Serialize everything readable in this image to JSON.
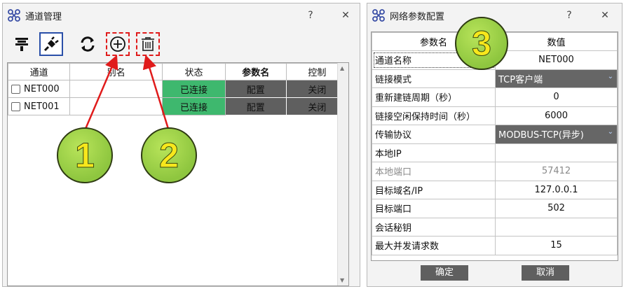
{
  "left_window": {
    "title": "通道管理",
    "help_label": "?",
    "close_label": "✕",
    "columns": [
      "通道",
      "别名",
      "状态",
      "参数名",
      "控制"
    ],
    "rows": [
      {
        "channel": "NET000",
        "alias": "",
        "status": "已连接",
        "param_btn": "配置",
        "control_btn": "关闭"
      },
      {
        "channel": "NET001",
        "alias": "",
        "status": "已连接",
        "param_btn": "配置",
        "control_btn": "关闭"
      }
    ],
    "toolbar": [
      "plug-icon",
      "ethernet-icon",
      "refresh-icon",
      "add-icon",
      "delete-icon"
    ]
  },
  "right_window": {
    "title": "网络参数配置",
    "help_label": "?",
    "close_label": "✕",
    "header": {
      "key": "参数名",
      "value": "数值"
    },
    "params": [
      {
        "key": "通道名称",
        "value": "NET000",
        "kind": "text"
      },
      {
        "key": "链接模式",
        "value": "TCP客户端",
        "kind": "dropdown"
      },
      {
        "key": "重新建链周期（秒）",
        "value": "0",
        "kind": "text"
      },
      {
        "key": "链接空闲保持时间（秒）",
        "value": "6000",
        "kind": "text"
      },
      {
        "key": "传输协议",
        "value": "MODBUS-TCP(异步)",
        "kind": "dropdown"
      },
      {
        "key": "本地IP",
        "value": "",
        "kind": "text"
      },
      {
        "key": "本地端口",
        "value": "57412",
        "kind": "disabled"
      },
      {
        "key": "目标域名/IP",
        "value": "127.0.0.1",
        "kind": "text"
      },
      {
        "key": "目标端口",
        "value": "502",
        "kind": "text"
      },
      {
        "key": "会话秘钥",
        "value": "",
        "kind": "text"
      },
      {
        "key": "最大并发请求数",
        "value": "15",
        "kind": "text"
      }
    ],
    "ok_label": "确定",
    "cancel_label": "取消"
  },
  "callouts": [
    "1",
    "2",
    "3"
  ],
  "colors": {
    "status_green": "#3eb86e",
    "grey_button": "#5f5f5f",
    "callout_green": "#8ec63f",
    "callout_text": "#f7e71c",
    "arrow_red": "#e01b1b"
  }
}
